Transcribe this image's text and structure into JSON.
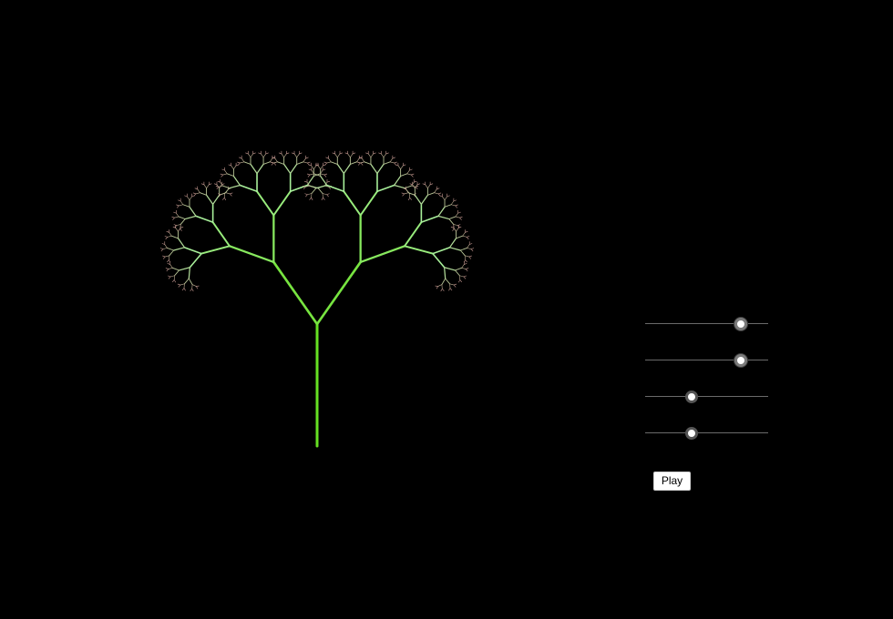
{
  "colors": {
    "background": "#000000",
    "trunk": "#66e022",
    "branch_mid": "#a8f09a",
    "branch_tip": "#c89a92",
    "slider_track": "#6a6a6a",
    "slider_thumb": "#ffffff"
  },
  "controls": {
    "sliders": [
      {
        "name": "slider-1",
        "value": 0.78
      },
      {
        "name": "slider-2",
        "value": 0.78
      },
      {
        "name": "slider-3",
        "value": 0.38
      },
      {
        "name": "slider-4",
        "value": 0.38
      }
    ],
    "play_label": "Play"
  }
}
